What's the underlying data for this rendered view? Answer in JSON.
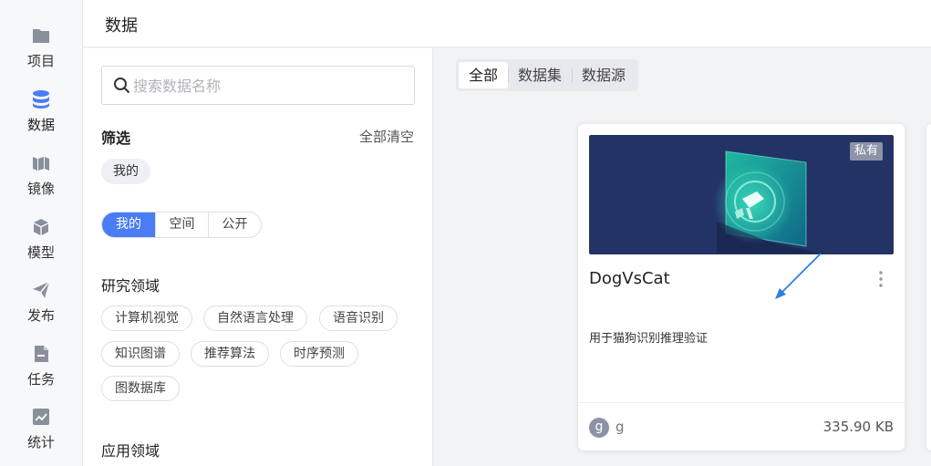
{
  "nav": {
    "items": [
      {
        "label": "项目",
        "icon": "folder-icon"
      },
      {
        "label": "数据",
        "icon": "database-icon",
        "active": true
      },
      {
        "label": "镜像",
        "icon": "map-icon"
      },
      {
        "label": "模型",
        "icon": "cube-icon"
      },
      {
        "label": "发布",
        "icon": "send-icon"
      },
      {
        "label": "任务",
        "icon": "task-file-icon"
      },
      {
        "label": "统计",
        "icon": "chart-icon"
      }
    ]
  },
  "header": {
    "title": "数据"
  },
  "filter": {
    "search_placeholder": "搜索数据名称",
    "title": "筛选",
    "clear_all": "全部清空",
    "active_chip": "我的",
    "scope": {
      "options": [
        "我的",
        "空间",
        "公开"
      ],
      "selected": "我的"
    },
    "research": {
      "title": "研究领域",
      "tags": [
        "计算机视觉",
        "自然语言处理",
        "语音识别",
        "知识图谱",
        "推荐算法",
        "时序预测",
        "图数据库"
      ]
    },
    "application": {
      "title": "应用领域"
    }
  },
  "main": {
    "tabs": [
      {
        "label": "全部",
        "selected": true
      },
      {
        "label": "数据集"
      },
      {
        "label": "数据源"
      }
    ],
    "card": {
      "badge": "私有",
      "name": "DogVsCat",
      "description": "用于猫狗识别推理验证",
      "avatar_letter": "g",
      "owner": "g",
      "size": "335.90 KB"
    }
  },
  "colors": {
    "accent": "#4a7cf6",
    "cover_bg": "#233366",
    "badge_bg": "#8d93a8"
  }
}
